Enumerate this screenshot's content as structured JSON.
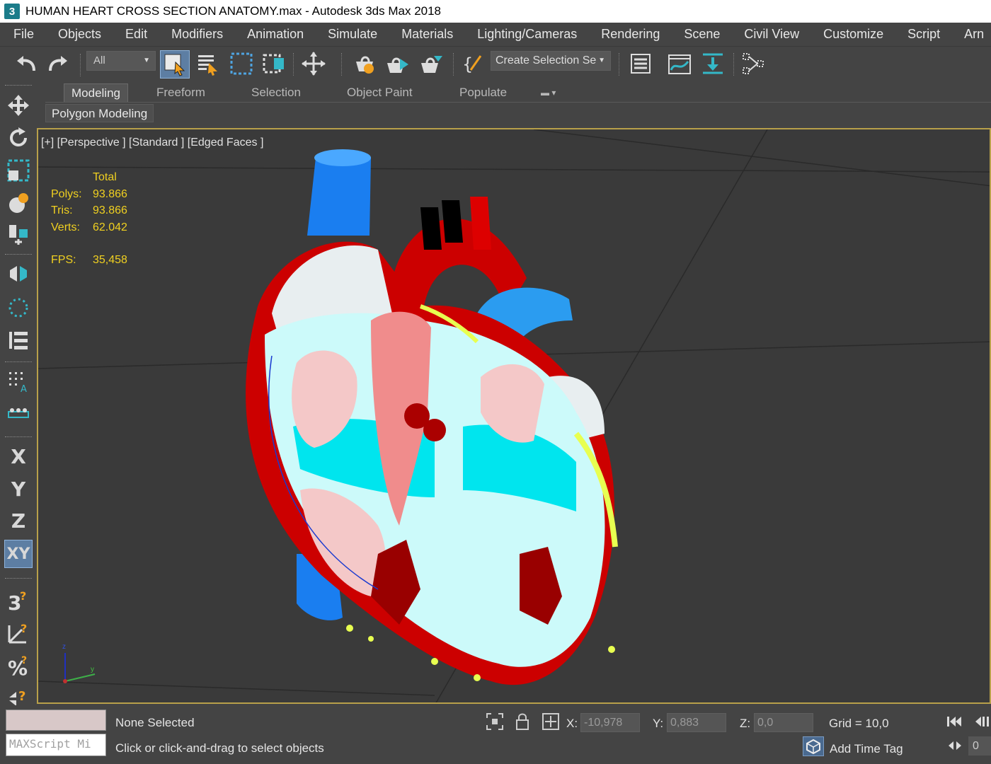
{
  "window": {
    "icon_text": "3",
    "title": "HUMAN HEART CROSS SECTION ANATOMY.max - Autodesk 3ds Max 2018"
  },
  "menu": [
    "File",
    "Objects",
    "Edit",
    "Modifiers",
    "Animation",
    "Simulate",
    "Materials",
    "Lighting/Cameras",
    "Rendering",
    "Scene",
    "Civil View",
    "Customize",
    "Script",
    "Arn"
  ],
  "toolbar": {
    "filter_value": "All",
    "selection_set": "Create Selection Se",
    "icons": [
      "undo-icon",
      "redo-icon",
      "select-object-icon",
      "select-by-name-icon",
      "rectangular-selection-icon",
      "window-crossing-icon",
      "select-move-icon",
      "render-setup-icon",
      "rendered-frame-window-icon",
      "render-production-icon",
      "edit-named-selection-icon",
      "layer-explorer-icon",
      "curve-editor-icon",
      "toggle-ribbon-icon",
      "schematic-view-icon"
    ]
  },
  "ribbon": {
    "tabs": [
      "Modeling",
      "Freeform",
      "Selection",
      "Object Paint",
      "Populate"
    ],
    "active_tab": "Modeling",
    "panel_label": "Polygon Modeling"
  },
  "left_toolbar": {
    "axis_labels": [
      "X",
      "Y",
      "Z",
      "XY"
    ],
    "icons": [
      "move-icon",
      "rotate-icon",
      "scale-icon",
      "place-icon",
      "align-icon",
      "mirror-icon",
      "snap-icon",
      "array-icon",
      "spacing-tool-icon",
      "clone-icon",
      "snaps-3d-icon",
      "angle-snap-icon",
      "percent-snap-icon",
      "spinner-snap-icon"
    ]
  },
  "viewport": {
    "label": "[+] [Perspective ] [Standard ] [Edged Faces ]",
    "stats": {
      "header": "Total",
      "polys_label": "Polys:",
      "polys": "93.866",
      "tris_label": "Tris:",
      "tris": "93.866",
      "verts_label": "Verts:",
      "verts": "62.042",
      "fps_label": "FPS:",
      "fps": "35,458"
    },
    "gizmo": {
      "z": "z",
      "y": "y"
    }
  },
  "status": {
    "maxscript_placeholder": "MAXScript Mi",
    "selection": "None Selected",
    "prompt": "Click or click-and-drag to select objects",
    "x_label": "X:",
    "x": "-10,978",
    "y_label": "Y:",
    "y": "0,883",
    "z_label": "Z:",
    "z": "0,0",
    "grid": "Grid = 10,0",
    "time_tag": "Add Time Tag",
    "frame": "0"
  },
  "colors": {
    "viewport_border": "#b8a04a",
    "stats_text": "#f0d020",
    "ui_bg": "#444444",
    "viewport_bg": "#3a3a3a"
  }
}
